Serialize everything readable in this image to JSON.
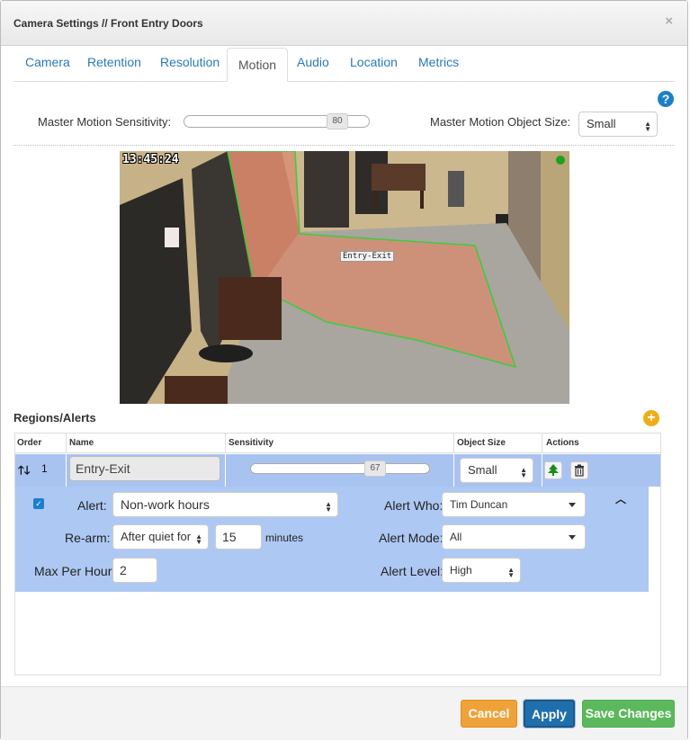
{
  "dialog": {
    "title": "Camera Settings // Front Entry Doors",
    "close_icon": "×"
  },
  "tabs": [
    {
      "label": "Camera"
    },
    {
      "label": "Retention"
    },
    {
      "label": "Resolution"
    },
    {
      "label": "Motion",
      "active": true
    },
    {
      "label": "Audio"
    },
    {
      "label": "Location"
    },
    {
      "label": "Metrics"
    }
  ],
  "motion": {
    "sensitivity_label": "Master Motion Sensitivity:",
    "sensitivity_value": "80",
    "object_size_label": "Master Motion Object Size:",
    "object_size_value": "Small"
  },
  "camera_view": {
    "timestamp": "13:45:24",
    "region_label": "Entry-Exit",
    "status_color": "#1da11d"
  },
  "regions": {
    "title": "Regions/Alerts",
    "columns": [
      "Order",
      "Name",
      "Sensitivity",
      "Object Size",
      "Actions"
    ],
    "row": {
      "order": "1",
      "name": "Entry-Exit",
      "sensitivity": "67",
      "object_size": "Small"
    },
    "detail": {
      "alert_label": "Alert:",
      "alert_value": "Non-work hours",
      "rearm_label": "Re-arm:",
      "rearm_value": "After quiet for",
      "rearm_minutes": "15",
      "minutes_label": "minutes",
      "max_per_hour_label": "Max Per Hour:",
      "max_per_hour_value": "2",
      "alert_who_label": "Alert Who:",
      "alert_who_value": "Tim Duncan",
      "alert_mode_label": "Alert Mode:",
      "alert_mode_value": "All",
      "alert_level_label": "Alert Level:",
      "alert_level_value": "High"
    }
  },
  "footer": {
    "cancel": "Cancel",
    "apply": "Apply",
    "save": "Save Changes"
  },
  "colors": {
    "accent": "#1b7fc9",
    "cancel": "#f0a23a",
    "apply": "#1f6fad",
    "save": "#5cb85c",
    "row_selected": "#a9c3f0"
  }
}
